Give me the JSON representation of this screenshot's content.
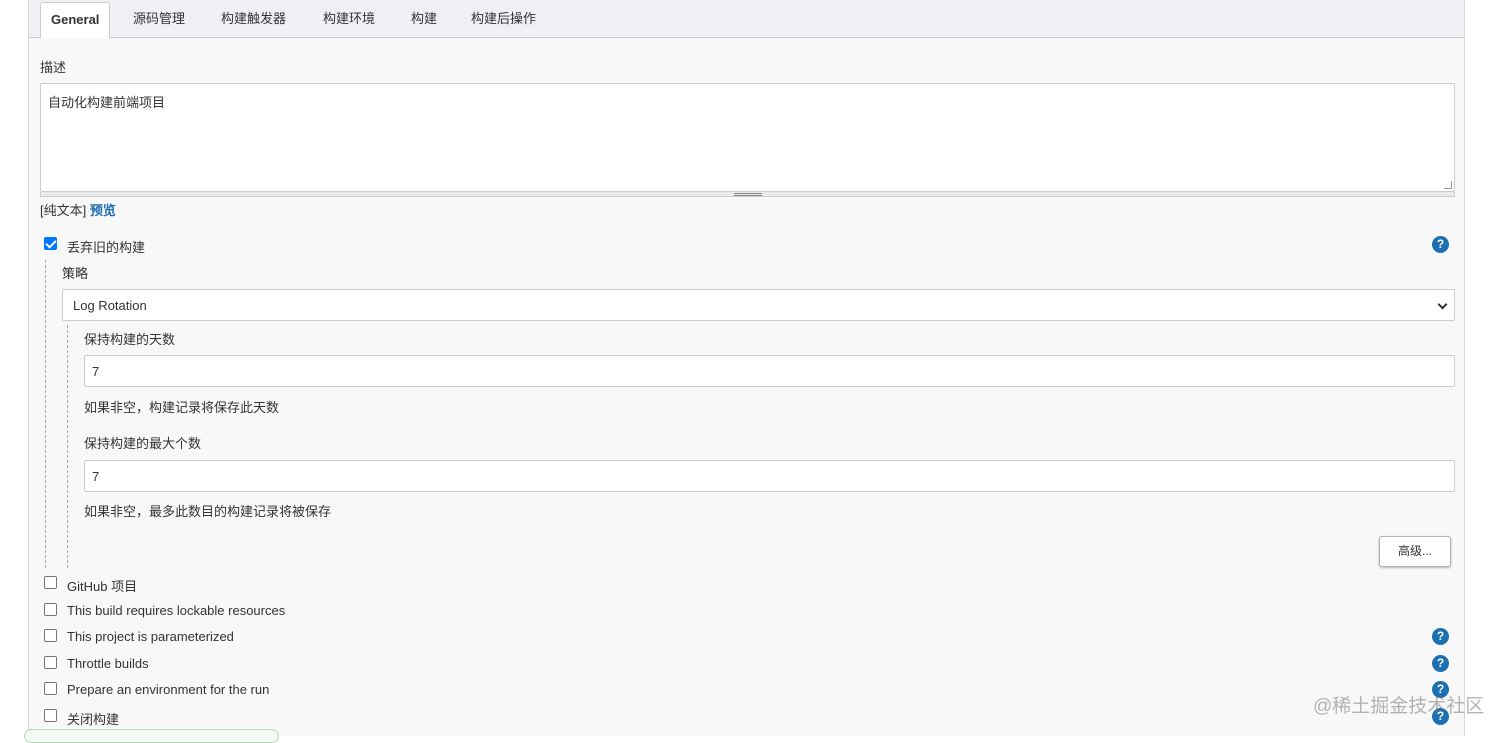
{
  "tabs": [
    {
      "label": "General"
    },
    {
      "label": "源码管理"
    },
    {
      "label": "构建触发器"
    },
    {
      "label": "构建环境"
    },
    {
      "label": "构建"
    },
    {
      "label": "构建后操作"
    }
  ],
  "description": {
    "label": "描述",
    "value": "自动化构建前端项目",
    "plain_text": "[纯文本]",
    "preview": "预览"
  },
  "discard_old_builds": {
    "label": "丢弃旧的构建",
    "checked": true,
    "strategy_label": "策略",
    "strategy_value": "Log Rotation",
    "days_label": "保持构建的天数",
    "days_value": "7",
    "days_hint": "如果非空，构建记录将保存此天数",
    "max_label": "保持构建的最大个数",
    "max_value": "7",
    "max_hint": "如果非空，最多此数目的构建记录将被保存",
    "advanced_button": "高级..."
  },
  "options": [
    {
      "label": "GitHub 项目",
      "checked": false,
      "help": false
    },
    {
      "label": "This build requires lockable resources",
      "checked": false,
      "help": false
    },
    {
      "label": "This project is parameterized",
      "checked": false,
      "help": true
    },
    {
      "label": "Throttle builds",
      "checked": false,
      "help": true
    },
    {
      "label": "Prepare an environment for the run",
      "checked": false,
      "help": true
    },
    {
      "label": "关闭构建",
      "checked": false,
      "help": true
    }
  ],
  "help_icon_glyph": "?",
  "watermark": "@稀土掘金技术社区",
  "colors": {
    "accent": "#1c6fb0",
    "checkbox": "#0075ff",
    "link": "#1b6db3"
  }
}
